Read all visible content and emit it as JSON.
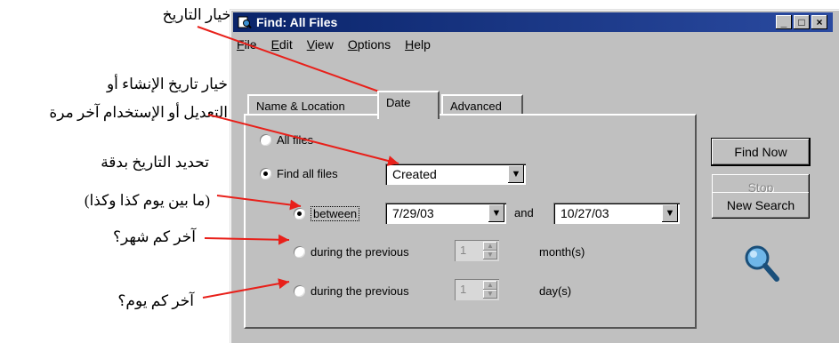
{
  "annotations": {
    "date_option": "خيار التاريخ",
    "created_modified_line1": "خيار تاريخ الإنشاء أو",
    "created_modified_line2": "التعديل أو الإستخدام آخر مرة",
    "date_range_line1": "تحديد التاريخ بدقة",
    "date_range_line2": "(ما بين يوم كذا وكذا)",
    "last_months": "آخر كم شهر؟",
    "last_days": "آخر كم يوم؟"
  },
  "window": {
    "title": "Find: All Files",
    "controls": [
      "_",
      "□",
      "×"
    ]
  },
  "menu": [
    "File",
    "Edit",
    "View",
    "Options",
    "Help"
  ],
  "tabs": [
    "Name & Location",
    "Date",
    "Advanced"
  ],
  "active_tab": "Date",
  "date_panel": {
    "all_files_label": "All files",
    "find_all_files_label": "Find all files",
    "find_all_files_type": "Created",
    "between_label": "between",
    "between_from": "7/29/03",
    "and_label": "and",
    "between_to": "10/27/03",
    "previous_months_label": "during the previous",
    "previous_months_value": "1",
    "months_unit": "month(s)",
    "previous_days_label": "during the previous",
    "previous_days_value": "1",
    "days_unit": "day(s)"
  },
  "buttons": {
    "find_now": "Find Now",
    "stop": "Stop",
    "new_search": "New Search"
  },
  "icons": {
    "window": "find-window-icon",
    "search": "magnifier-icon",
    "dropdown": "dropdown-arrow-icon"
  }
}
